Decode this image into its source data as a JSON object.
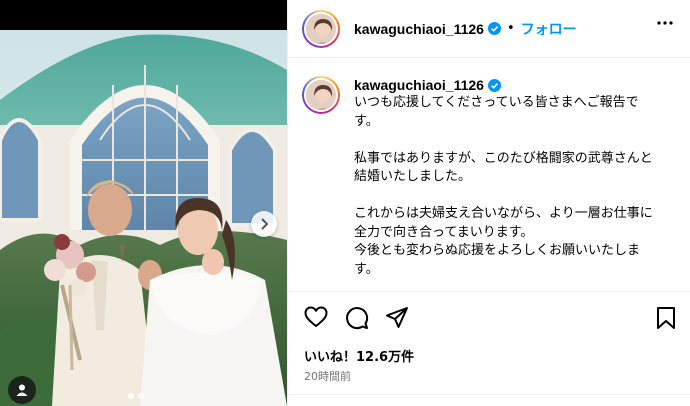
{
  "post": {
    "username": "kawaguchiaoi_1126",
    "separator": "•",
    "follow_label": "フォロー",
    "caption_lines": [
      "いつも応援してくださっている皆さまへご報告で",
      "す。",
      "",
      "私事ではありますが、このたび格闘家の武尊さんと",
      "結婚いたしました。",
      "",
      "これからは夫婦支え合いながら、より一層お仕事に",
      "全力で向き合ってまいります。",
      "今後とも変わらぬ応援をよろしくお願いいたしま",
      "す。"
    ],
    "likes": "いいね！12.6万件",
    "time_ago": "20時間前"
  },
  "colors": {
    "accent": "#0095f6",
    "verified": "#0095f6",
    "muted": "#737373"
  },
  "icons": [
    "verified-badge-icon",
    "more-options-icon",
    "heart-icon",
    "comment-icon",
    "share-icon",
    "bookmark-icon",
    "chevron-right-icon",
    "user-tag-icon"
  ]
}
